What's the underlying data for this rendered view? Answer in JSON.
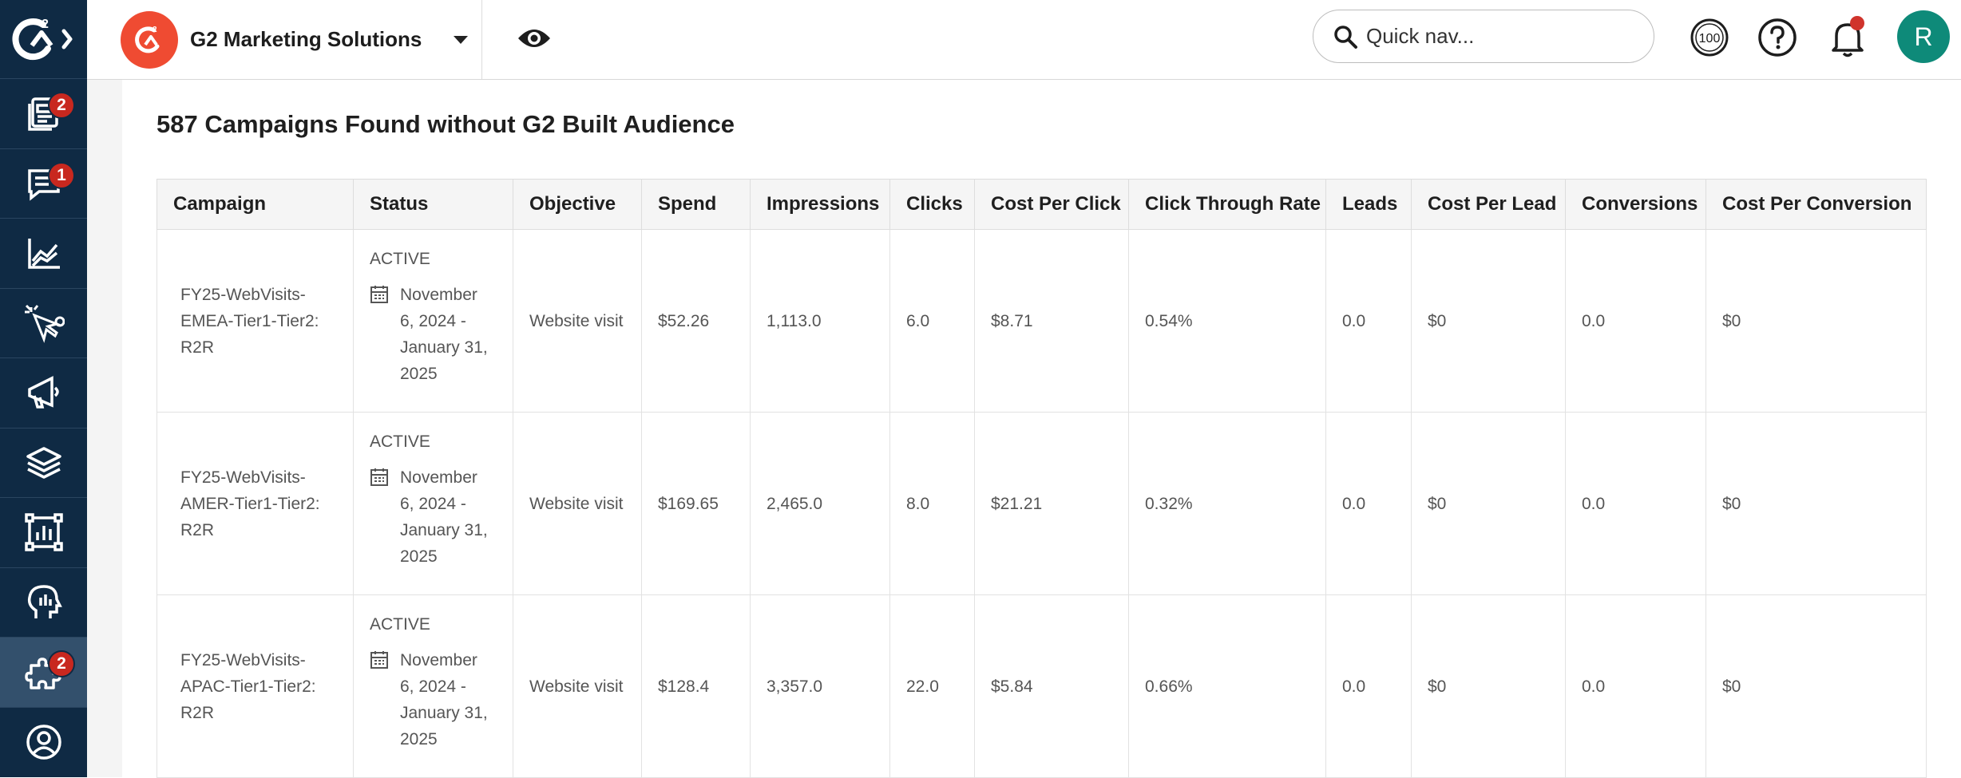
{
  "header": {
    "account_name": "G2 Marketing Solutions",
    "search_placeholder": "Quick nav...",
    "score_badge": "100",
    "avatar_initial": "R"
  },
  "sidebar": {
    "items": [
      {
        "icon": "feed-icon",
        "badge": "2"
      },
      {
        "icon": "chat-icon",
        "badge": "1"
      },
      {
        "icon": "analytics-chart-icon",
        "badge": ""
      },
      {
        "icon": "intent-cursor-icon",
        "badge": ""
      },
      {
        "icon": "megaphone-icon",
        "badge": ""
      },
      {
        "icon": "layers-icon",
        "badge": ""
      },
      {
        "icon": "report-icon",
        "badge": ""
      },
      {
        "icon": "head-insights-icon",
        "badge": ""
      },
      {
        "icon": "puzzle-integrations-icon",
        "badge": "2"
      },
      {
        "icon": "user-circle-icon",
        "badge": ""
      }
    ]
  },
  "main": {
    "title": "587 Campaigns Found without G2 Built Audience",
    "columns": [
      "Campaign",
      "Status",
      "Objective",
      "Spend",
      "Impressions",
      "Clicks",
      "Cost Per Click",
      "Click Through Rate",
      "Leads",
      "Cost Per Lead",
      "Conversions",
      "Cost Per Conversion"
    ],
    "rows": [
      {
        "campaign": "FY25-WebVisits-EMEA-Tier1-Tier2: R2R",
        "status": "ACTIVE",
        "dates": "November 6, 2024 - January 31, 2025",
        "objective": "Website visit",
        "spend": "$52.26",
        "impressions": "1,113.0",
        "clicks": "6.0",
        "cpc": "$8.71",
        "ctr": "0.54%",
        "leads": "0.0",
        "cpl": "$0",
        "conversions": "0.0",
        "cpconv": "$0"
      },
      {
        "campaign": "FY25-WebVisits-AMER-Tier1-Tier2: R2R",
        "status": "ACTIVE",
        "dates": "November 6, 2024 - January 31, 2025",
        "objective": "Website visit",
        "spend": "$169.65",
        "impressions": "2,465.0",
        "clicks": "8.0",
        "cpc": "$21.21",
        "ctr": "0.32%",
        "leads": "0.0",
        "cpl": "$0",
        "conversions": "0.0",
        "cpconv": "$0"
      },
      {
        "campaign": "FY25-WebVisits-APAC-Tier1-Tier2: R2R",
        "status": "ACTIVE",
        "dates": "November 6, 2024 - January 31, 2025",
        "objective": "Website visit",
        "spend": "$128.4",
        "impressions": "3,357.0",
        "clicks": "22.0",
        "cpc": "$5.84",
        "ctr": "0.66%",
        "leads": "0.0",
        "cpl": "$0",
        "conversions": "0.0",
        "cpconv": "$0"
      }
    ]
  }
}
